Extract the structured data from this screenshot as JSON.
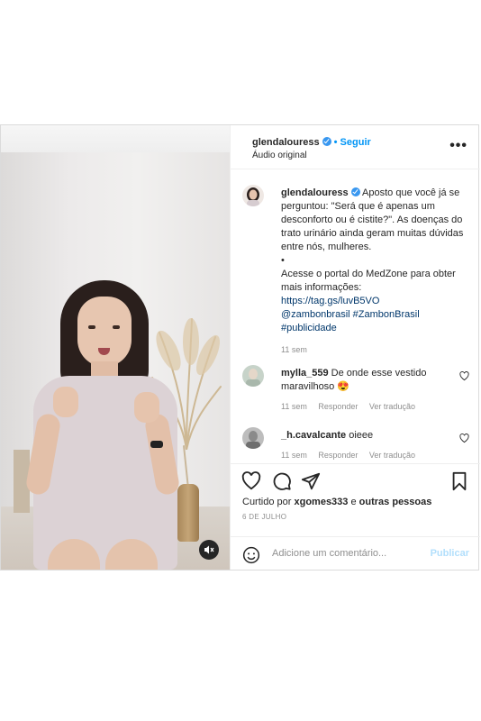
{
  "post": {
    "author": "glendalouress",
    "follow_label": "• Seguir",
    "audio": "Áudio original",
    "more_label": "•••"
  },
  "caption": {
    "username": "glendalouress",
    "text_1": "Aposto que você já se perguntou: \"Será que é apenas um desconforto ou é cistite?\". As doenças do trato urinário ainda geram muitas dúvidas entre nós, mulheres.",
    "bullet": "•",
    "text_2": "Acesse o portal do MedZone para obter mais informações:",
    "url": "https://tag.gs/luvB5VO",
    "tag_1": "@zambonbrasil",
    "tag_2": "#ZambonBrasil",
    "tag_3": "#publicidade",
    "time": "11 sem"
  },
  "comments": [
    {
      "username": "mylla_559",
      "text": "De onde esse vestido maravilhoso 😍",
      "time": "11 sem",
      "reply": "Responder",
      "translate": "Ver tradução"
    },
    {
      "username": "_h.cavalcante",
      "text": "oieee",
      "time": "11 sem",
      "reply": "Responder",
      "translate": "Ver tradução"
    }
  ],
  "likes": {
    "prefix": "Curtido por",
    "user": "xgomes333",
    "joiner": "e",
    "others": "outras pessoas"
  },
  "date": "6 DE JULHO",
  "composer": {
    "placeholder": "Adicione um comentário...",
    "publish": "Publicar"
  },
  "colors": {
    "accent": "#0095f6",
    "verified": "#3897f0",
    "text": "#262626",
    "muted": "#8e8e8e"
  }
}
